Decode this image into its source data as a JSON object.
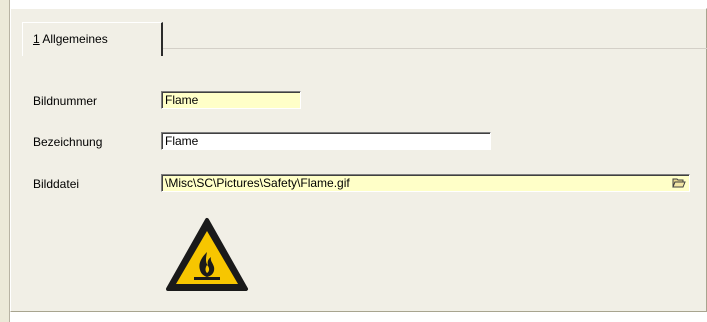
{
  "tabs": [
    {
      "number": "1",
      "label": " Allgemeines"
    }
  ],
  "form": {
    "bildnummer": {
      "label": "Bildnummer",
      "value": "Flame"
    },
    "bezeichnung": {
      "label": "Bezeichnung",
      "value": "Flame"
    },
    "bilddatei": {
      "label": "Bilddatei",
      "value": "\\Misc\\SC\\Pictures\\Safety\\Flame.gif",
      "button_icon": "folder-open-icon"
    }
  },
  "preview": {
    "icon": "flammable-warning-icon"
  },
  "colors": {
    "required_field": "#ffffc8",
    "panel": "#f1efe6",
    "warning_yellow": "#f7c600"
  }
}
